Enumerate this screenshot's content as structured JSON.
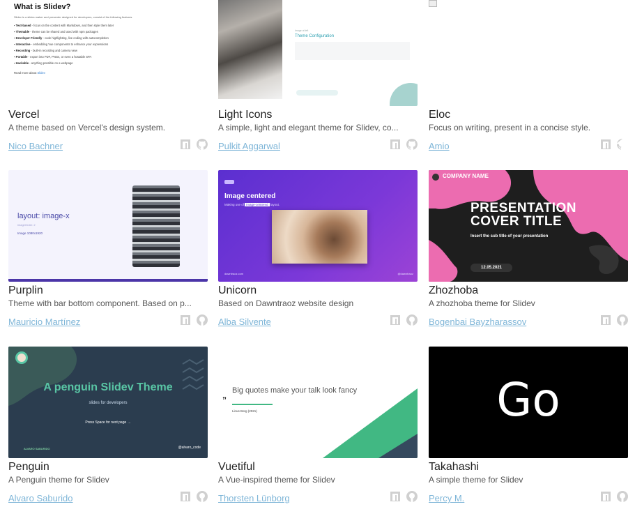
{
  "themes": [
    {
      "name": "Vercel",
      "description": "A theme based on Vercel's design system.",
      "author": "Nico Bachner"
    },
    {
      "name": "Light Icons",
      "description": "A simple, light and elegant theme for Slidev, co...",
      "author": "Pulkit Aggarwal"
    },
    {
      "name": "Eloc",
      "description": "Focus on writing, present in a concise style.",
      "author": "Amio"
    },
    {
      "name": "Purplin",
      "description": "Theme with bar bottom component. Based on p...",
      "author": "Mauricio Martínez"
    },
    {
      "name": "Unicorn",
      "description": "Based on Dawntraoz website design",
      "author": "Alba Silvente"
    },
    {
      "name": "Zhozhoba",
      "description": "A zhozhoba theme for Slidev",
      "author": "Bogenbai Bayzharassov"
    },
    {
      "name": "Penguin",
      "description": "A Penguin theme for Slidev",
      "author": "Alvaro Saburido"
    },
    {
      "name": "Vuetiful",
      "description": "A Vue-inspired theme for Slidev",
      "author": "Thorsten Lünborg"
    },
    {
      "name": "Takahashi",
      "description": "A simple theme for Slidev",
      "author": "Percy M."
    }
  ],
  "previews": {
    "vercel": {
      "heading": "What is Slidev?",
      "intro": "Slidev is a slides maker and presenter designed for developers, consist of the following features",
      "items": [
        {
          "title": "Text-based",
          "text": " - focus on the content with Markdown, and then style them later"
        },
        {
          "title": "Themable",
          "text": " - theme can be shared and used with npm packages"
        },
        {
          "title": "Developer Friendly",
          "text": " - code highlighting, live coding with autocompletion"
        },
        {
          "title": "Interactive",
          "text": " - embedding Vue components to enhance your expressions"
        },
        {
          "title": "Recording",
          "text": " - built-in recording and camera view"
        },
        {
          "title": "Portable",
          "text": " - export into PDF, PNGs, or even a hostable SPA"
        },
        {
          "title": "Hackable",
          "text": " - anything possible on a webpage"
        }
      ],
      "read_more": "Read more about",
      "read_more_link": "Slidev"
    },
    "light_icons": {
      "label": "Image at left",
      "heading": "Theme Configuration"
    },
    "purplin": {
      "layout": "layout: image-x",
      "order": "imageOrder: 2",
      "size": "Image 1080x1920"
    },
    "unicorn": {
      "heading": "Image centered",
      "sub_prefix": "Making use of",
      "sub_code": "image-centered",
      "sub_suffix": "layout.",
      "footer_left": "dawntraoz.com",
      "footer_right": "@dawntraoz"
    },
    "zhozhoba": {
      "company": "COMPANY NAME",
      "title_line1": "PRESENTATION",
      "title_line2": "COVER TITLE",
      "subtitle": "Insert the sub title of your presentation",
      "date": "12.05.2021"
    },
    "penguin": {
      "heading": "A penguin Slidev Theme",
      "sub": "slides for developers",
      "press": "Press Space for next page →",
      "footer_left": "ALVARO SABURIDO",
      "footer_right": "@alvaro_code"
    },
    "vuetiful": {
      "quote": "Big quotes make your talk look fancy",
      "author": "Linus Borg (2021)"
    },
    "takahashi": {
      "word": "Go"
    }
  },
  "colors": {
    "author_link": "#7fb6d8",
    "icon": "#d0d0d0"
  }
}
